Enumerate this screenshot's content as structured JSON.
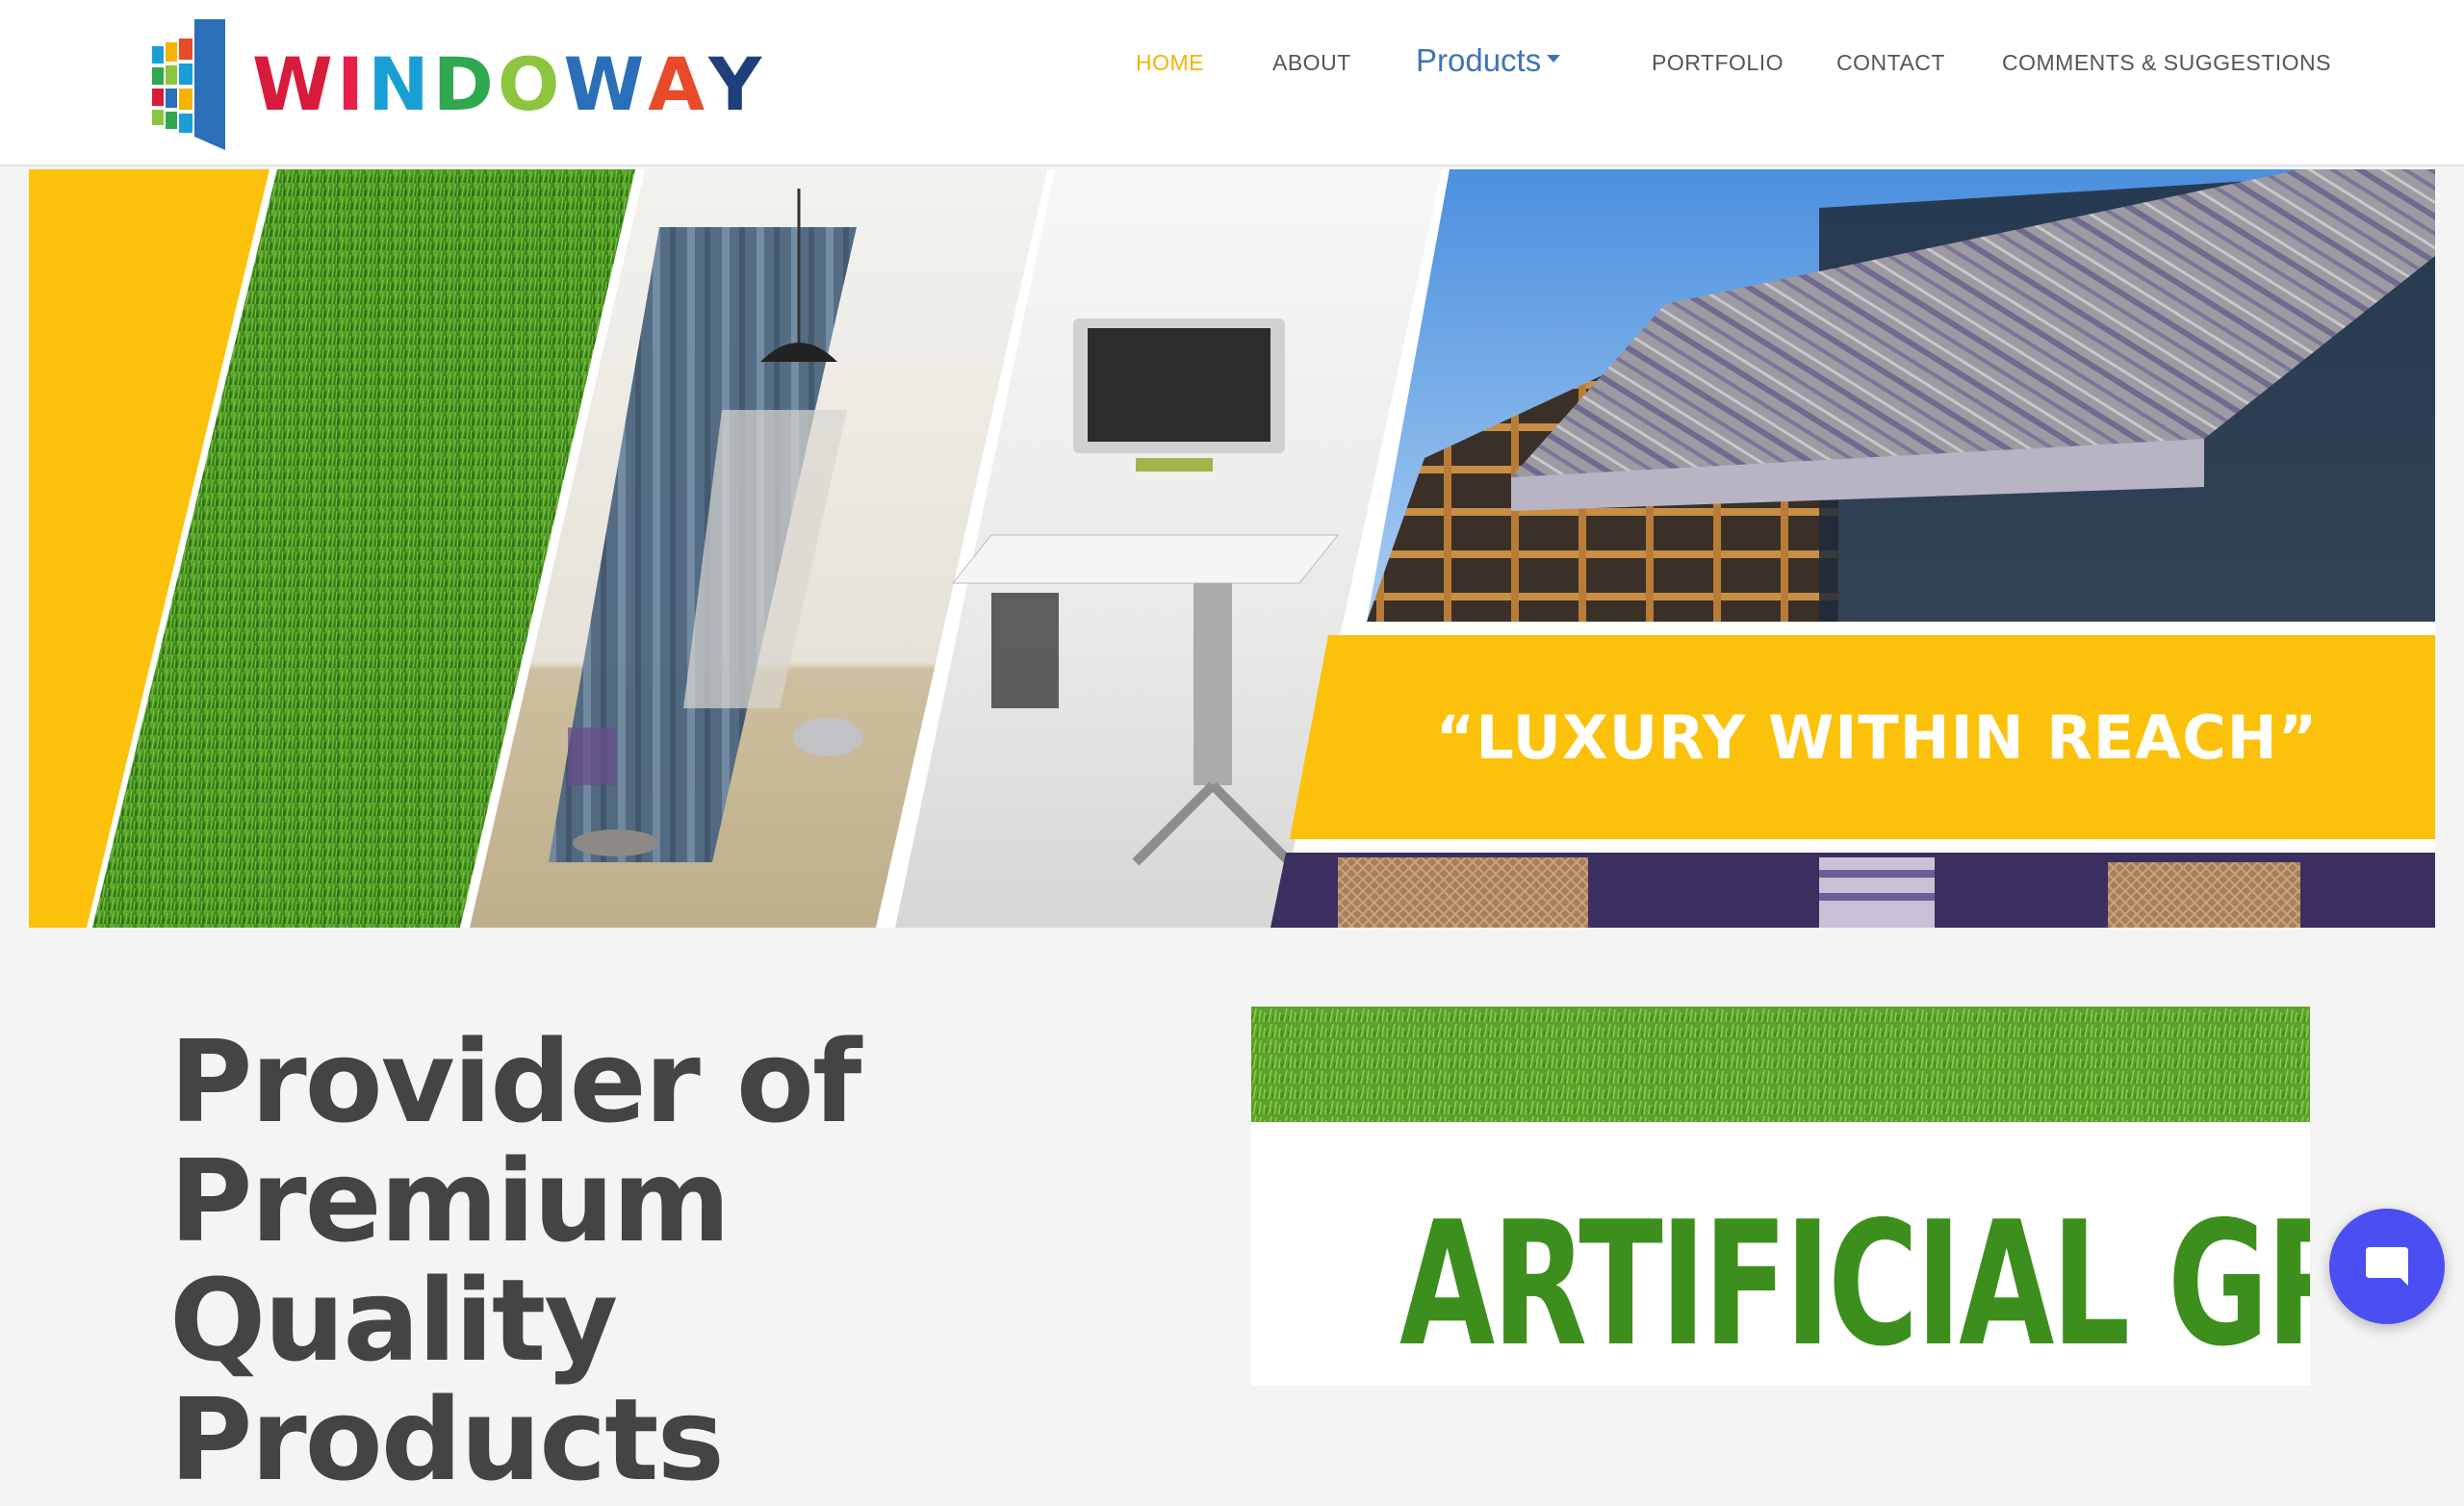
{
  "brand": {
    "name_letters": [
      "W",
      "I",
      "N",
      "D",
      "O",
      "W",
      "A",
      "Y"
    ],
    "letter_colors": [
      "#d81b3a",
      "#e8204a",
      "#1a9fd4",
      "#2fa84f",
      "#8cc63f",
      "#2a6fb8",
      "#e84a2a",
      "#1f3f7a"
    ],
    "logo_icon": "window-logo-icon"
  },
  "nav": {
    "items": [
      {
        "label": "HOME",
        "active": true
      },
      {
        "label": "ABOUT",
        "active": false
      },
      {
        "label": "Products",
        "active": false,
        "dropdown": true
      },
      {
        "label": "PORTFOLIO",
        "active": false
      },
      {
        "label": "CONTACT",
        "active": false
      },
      {
        "label": "COMMENTS & SUGGESTIONS",
        "active": false
      }
    ],
    "active_color": "#f4b400",
    "products_color": "#3f73b8"
  },
  "banner": {
    "tagline": "“LUXURY WITHIN REACH”",
    "accent_color": "#fcc10a",
    "panels": [
      "artificial-grass-image",
      "curtains-room-image",
      "office-blinds-image",
      "awning-image"
    ]
  },
  "hero": {
    "title_lines": [
      "Provider of",
      "Premium Quality",
      "Products"
    ]
  },
  "product_card": {
    "title": "ARTIFICIAL GRASS",
    "image": "grass-strip-image"
  },
  "chat": {
    "icon": "chat-bubble-icon",
    "color": "#4b4ef0"
  }
}
